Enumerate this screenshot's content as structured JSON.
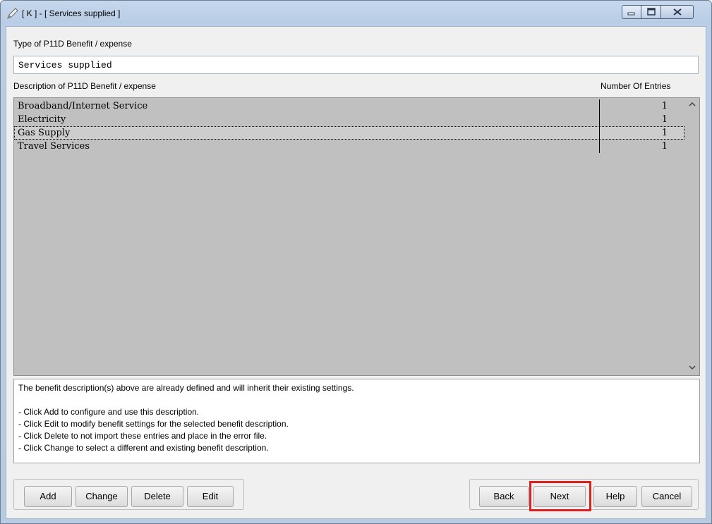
{
  "window": {
    "title": "[ K ] - [ Services supplied ]",
    "icon": "pencil-icon",
    "controls": [
      "minimize-icon",
      "maximize-icon",
      "close-icon"
    ]
  },
  "type_section": {
    "label": "Type of P11D Benefit / expense",
    "value": "Services supplied"
  },
  "list": {
    "col_description": "Description of P11D Benefit / expense",
    "col_count": "Number Of Entries",
    "rows": [
      {
        "description": "Broadband/Internet Service",
        "count": "1"
      },
      {
        "description": "Electricity",
        "count": "1"
      },
      {
        "description": "Gas Supply",
        "count": "1",
        "selected": true
      },
      {
        "description": "Travel Services",
        "count": "1"
      }
    ]
  },
  "info": {
    "lines": [
      "The benefit description(s) above are already defined and will inherit their existing settings.",
      "",
      "- Click Add to configure and use this description.",
      "- Click Edit to modify benefit settings for the selected benefit description.",
      "- Click Delete to not import these entries and place in the error file.",
      "- Click Change to select a different and existing benefit description."
    ]
  },
  "buttons": {
    "add": "Add",
    "change": "Change",
    "delete": "Delete",
    "edit": "Edit",
    "back": "Back",
    "next": "Next",
    "help": "Help",
    "cancel": "Cancel"
  },
  "colors": {
    "highlight": "#e02020",
    "list_background": "#c0c0c0"
  }
}
